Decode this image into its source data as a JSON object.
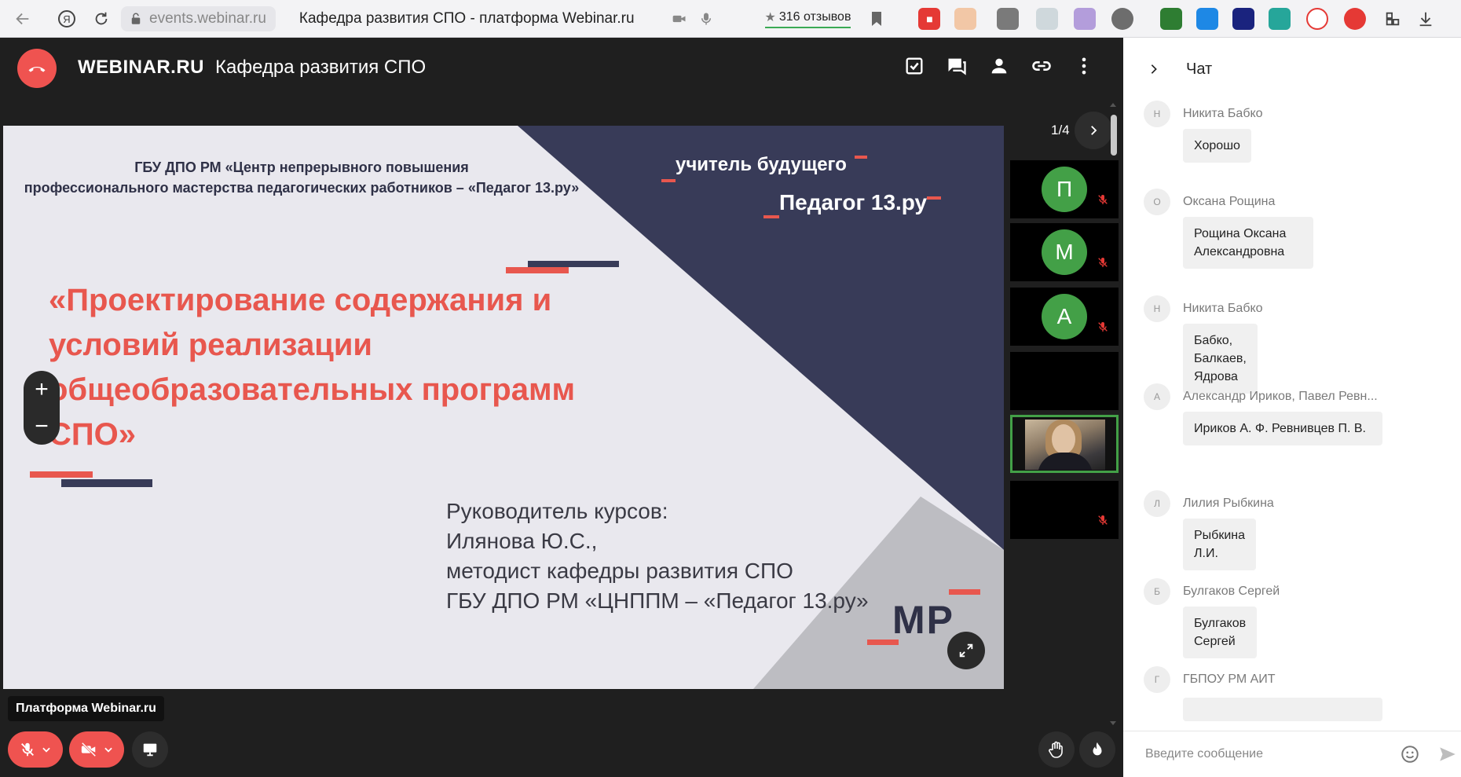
{
  "browser": {
    "url": "events.webinar.ru",
    "page_title": "Кафедра развития СПО - платформа Webinar.ru",
    "reviews": "316 отзывов"
  },
  "header": {
    "brand": "WEBINAR.RU",
    "room_title": "Кафедра развития СПО"
  },
  "slide": {
    "org_line1": "ГБУ ДПО РМ  «Центр непрерывного повышения",
    "org_line2": "профессионального мастерства педагогических работников – «Педагог 13.ру»",
    "tagline1": "учитель будущего",
    "tagline2": "Педагог 13.ру",
    "title": "«Проектирование содержания и условий реализации общеобразовательных программ СПО»",
    "author_line1": "Руководитель курсов:",
    "author_line2": "Илянова Ю.С.,",
    "author_line3": "методист кафедры развития СПО",
    "author_line4": "ГБУ ДПО РМ «ЦНППМ – «Педагог 13.ру»",
    "logo": "МР"
  },
  "zoom": {
    "plus": "+",
    "minus": "−"
  },
  "pager": "1/4",
  "participants": [
    {
      "initial": "П"
    },
    {
      "initial": "М"
    },
    {
      "initial": "А"
    }
  ],
  "tooltip": "Платформа Webinar.ru",
  "chat": {
    "title": "Чат",
    "input_placeholder": "Введите сообщение",
    "messages": [
      {
        "initial": "Н",
        "author": "Никита Бабко",
        "text": "Хорошо"
      },
      {
        "initial": "О",
        "author": "Оксана Рощина",
        "text": "Рощина Оксана Александровна"
      },
      {
        "initial": "Н",
        "author": "Никита Бабко",
        "text": "Бабко, Балкаев, Ядрова"
      },
      {
        "initial": "А",
        "author": "Александр Ириков, Павел Ревн...",
        "text": "Ириков А. Ф. Ревнивцев П. В."
      },
      {
        "initial": "Л",
        "author": "Лилия Рыбкина",
        "text": "Рыбкина Л.И."
      },
      {
        "initial": "Б",
        "author": "Булгаков Сергей",
        "text": "Булгаков Сергей"
      },
      {
        "initial": "Г",
        "author": "ГБПОУ РМ АИТ",
        "text": ""
      }
    ]
  },
  "colors": {
    "accent_red": "#ef5350",
    "slide_navy": "#383b58",
    "slide_title_red": "#e8574e",
    "avatar_green": "#43a047"
  }
}
